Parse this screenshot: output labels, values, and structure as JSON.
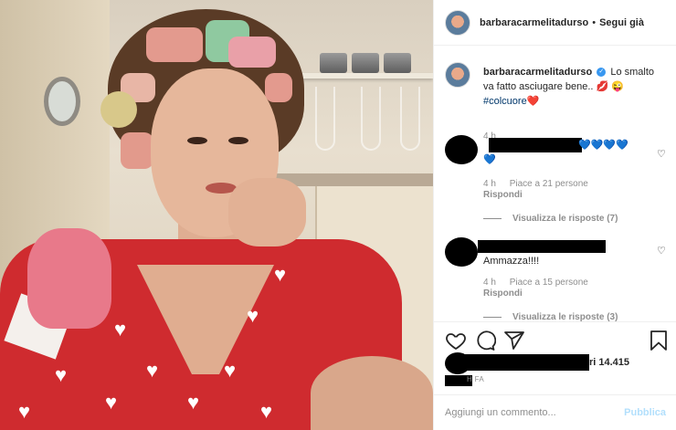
{
  "header": {
    "username": "barbaracarmelitadurso",
    "separator": "•",
    "follow_label": "Segui già"
  },
  "caption": {
    "username": "barbaracarmelitadurso",
    "verified_glyph": "✓",
    "text": "Lo smalto va fatto asciugare bene..",
    "emoji": "💋 😜",
    "hashtag": "#colcuore",
    "hashtag_emoji": "❤️",
    "time": "4 h"
  },
  "comments": [
    {
      "text": "💙💙💙💙",
      "text_line2": "💙",
      "time": "4 h",
      "likes": "Piace a 21 persone",
      "reply_label": "Rispondi",
      "view_replies": "Visualizza le risposte (7)"
    },
    {
      "text": "Ammazza!!!!",
      "time": "4 h",
      "likes": "Piace a 15 persone",
      "reply_label": "Rispondi",
      "view_replies": "Visualizza le risposte (3)"
    }
  ],
  "actions": {
    "likes_suffix": "ri 14.415",
    "ago": "H FA"
  },
  "add_comment": {
    "placeholder": "Aggiungi un commento...",
    "publish_label": "Pubblica"
  },
  "colors": {
    "text": "#262626",
    "secondary": "#8e8e8e",
    "publish_disabled": "#b2dffc",
    "verified": "#3897f0",
    "hashtag": "#00376b",
    "dress": "#cf2b2f"
  },
  "icons": {
    "like": "heart-icon",
    "comment": "comment-icon",
    "share": "share-icon",
    "save": "bookmark-icon"
  }
}
